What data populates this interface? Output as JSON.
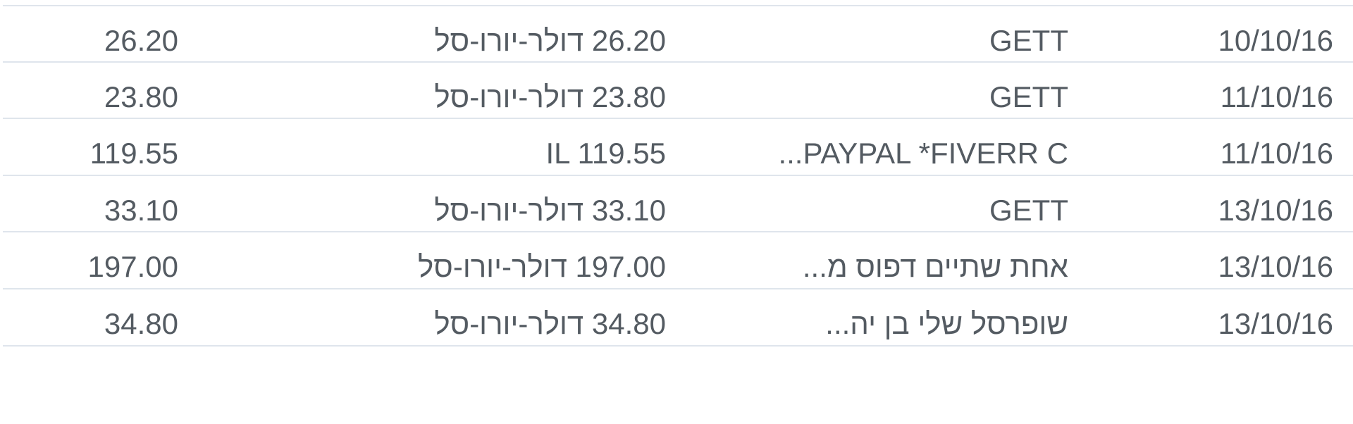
{
  "transactions": [
    {
      "date": "10/10/16",
      "merchant": "GETT",
      "original_amount": "26.20 דולר-יורו-סל",
      "charged_amount": "26.20"
    },
    {
      "date": "11/10/16",
      "merchant": "GETT",
      "original_amount": "23.80 דולר-יורו-סל",
      "charged_amount": "23.80"
    },
    {
      "date": "11/10/16",
      "merchant": "...PAYPAL *FIVERR C",
      "original_amount": "IL 119.55",
      "charged_amount": "119.55"
    },
    {
      "date": "13/10/16",
      "merchant": "GETT",
      "original_amount": "33.10 דולר-יורו-סל",
      "charged_amount": "33.10"
    },
    {
      "date": "13/10/16",
      "merchant": "אחת שתיים דפוס מ...",
      "original_amount": "197.00 דולר-יורו-סל",
      "charged_amount": "197.00"
    },
    {
      "date": "13/10/16",
      "merchant": "שופרסל שלי בן יה...",
      "original_amount": "34.80 דולר-יורו-סל",
      "charged_amount": "34.80"
    }
  ],
  "colors": {
    "text": "#545b62",
    "divider": "#dfe5ec",
    "background": "#ffffff"
  }
}
